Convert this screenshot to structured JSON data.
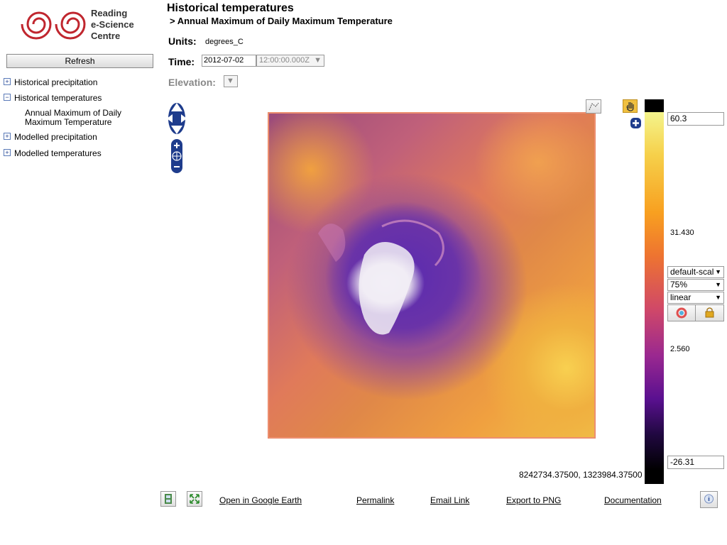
{
  "logo": {
    "line1": "Reading",
    "line2": "e-Science",
    "line3": "Centre"
  },
  "sidebar": {
    "refresh_label": "Refresh",
    "items": [
      {
        "label": "Historical precipitation",
        "toggle": "+"
      },
      {
        "label": "Historical temperatures",
        "toggle": "−"
      },
      {
        "label": "Modelled precipitation",
        "toggle": "+"
      },
      {
        "label": "Modelled temperatures",
        "toggle": "+"
      }
    ],
    "child": {
      "label": "Annual Maximum of Daily Maximum Temperature"
    }
  },
  "header": {
    "title": "Historical temperatures",
    "subtitle": "> Annual Maximum of Daily Maximum Temperature",
    "units_label": "Units:",
    "units_value": "degrees_C",
    "time_label": "Time:",
    "date_value": "2012-07-02",
    "time_value": "12:00:00.000Z",
    "elevation_label": "Elevation:"
  },
  "map": {
    "coordinates": "8242734.37500, 1323984.37500"
  },
  "colorbar": {
    "max": "60.3",
    "mid_high": "31.430",
    "mid_low": "2.560",
    "min": "-26.31",
    "palette": "default-scal",
    "opacity": "75%",
    "scaling": "linear"
  },
  "footer": {
    "google_earth": "Open in Google Earth",
    "permalink": "Permalink",
    "email": "Email Link",
    "export": "Export to PNG",
    "docs": "Documentation"
  },
  "colors": {
    "nav_blue": "#1e3c8c",
    "logo_red": "#c0262e"
  }
}
